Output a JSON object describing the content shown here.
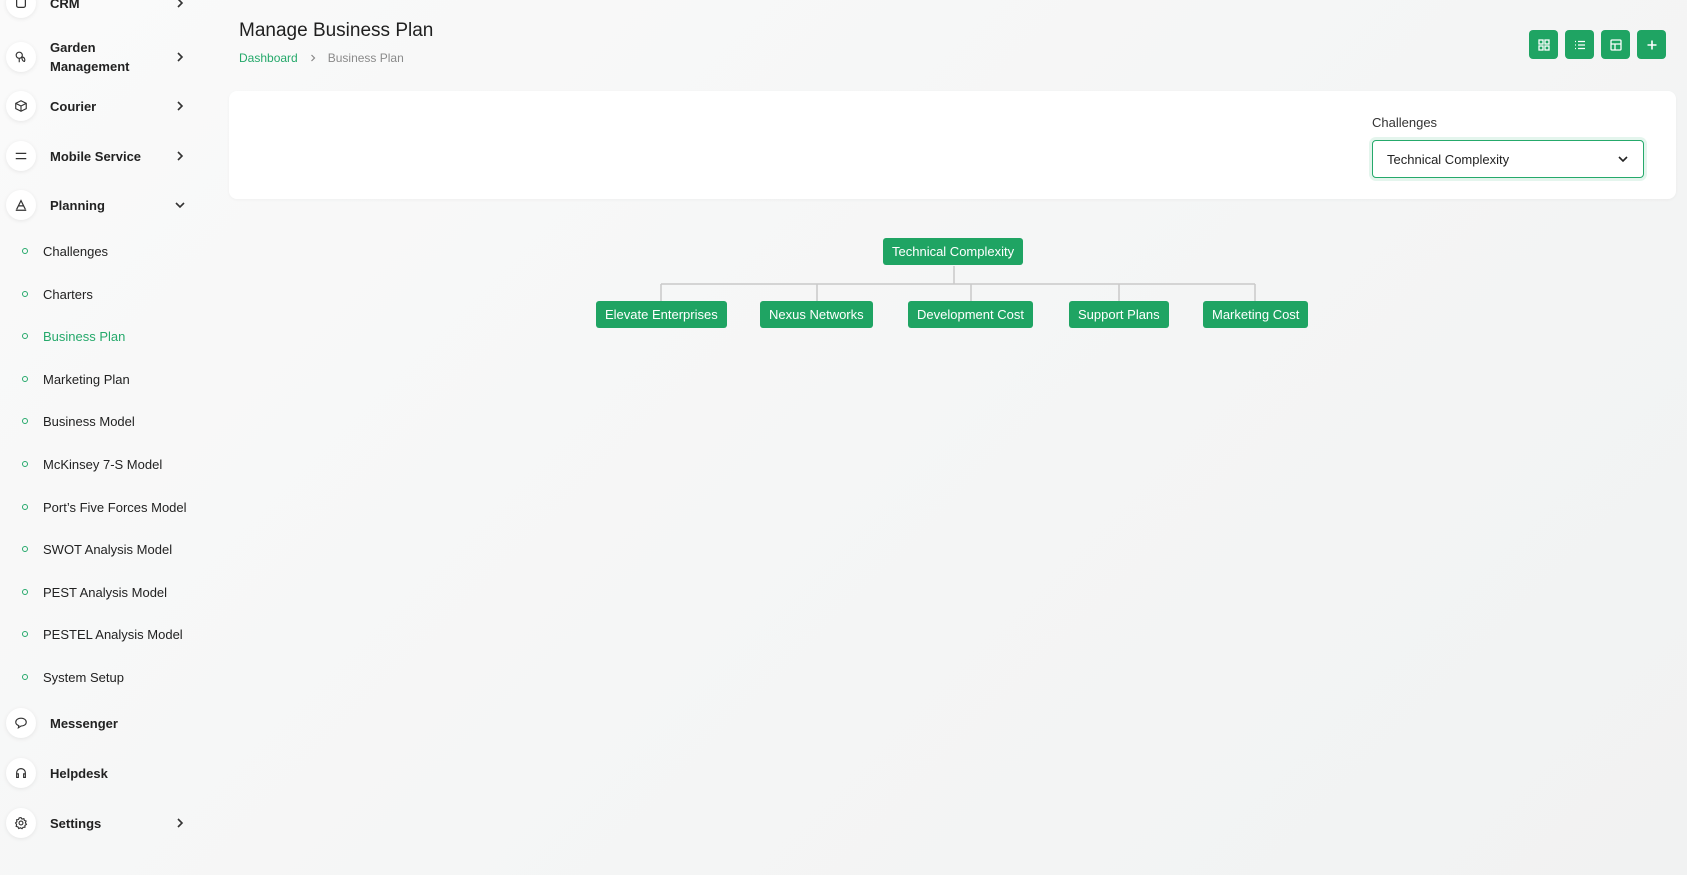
{
  "sidebar": {
    "items": [
      {
        "label": "CRM",
        "icon": "crm-icon"
      },
      {
        "label": "Garden Management",
        "icon": "garden-icon"
      },
      {
        "label": "Courier",
        "icon": "box-icon"
      },
      {
        "label": "Mobile Service",
        "icon": "menu-icon"
      },
      {
        "label": "Planning",
        "icon": "planning-icon"
      },
      {
        "label": "Messenger",
        "icon": "chat-icon"
      },
      {
        "label": "Helpdesk",
        "icon": "headset-icon"
      },
      {
        "label": "Settings",
        "icon": "gear-icon"
      }
    ],
    "planning_sub": [
      {
        "label": "Challenges"
      },
      {
        "label": "Charters"
      },
      {
        "label": "Business Plan",
        "active": true
      },
      {
        "label": "Marketing Plan"
      },
      {
        "label": "Business Model"
      },
      {
        "label": "McKinsey 7-S Model"
      },
      {
        "label": "Port’s Five Forces Model"
      },
      {
        "label": "SWOT Analysis Model"
      },
      {
        "label": "PEST Analysis Model"
      },
      {
        "label": "PESTEL Analysis Model"
      },
      {
        "label": "System Setup"
      }
    ]
  },
  "header": {
    "title": "Manage Business Plan",
    "breadcrumb": {
      "home": "Dashboard",
      "current": "Business Plan"
    },
    "toolbar": [
      "grid-view-icon",
      "list-view-icon",
      "table-view-icon",
      "plus-icon"
    ]
  },
  "filter": {
    "label": "Challenges",
    "selected": "Technical Complexity"
  },
  "tree": {
    "root": "Technical Complexity",
    "children": [
      "Elevate Enterprises",
      "Nexus Networks",
      "Development Cost",
      "Support Plans",
      "Marketing Cost"
    ]
  },
  "colors": {
    "accent": "#1fa463",
    "active_text": "#25a96b"
  }
}
